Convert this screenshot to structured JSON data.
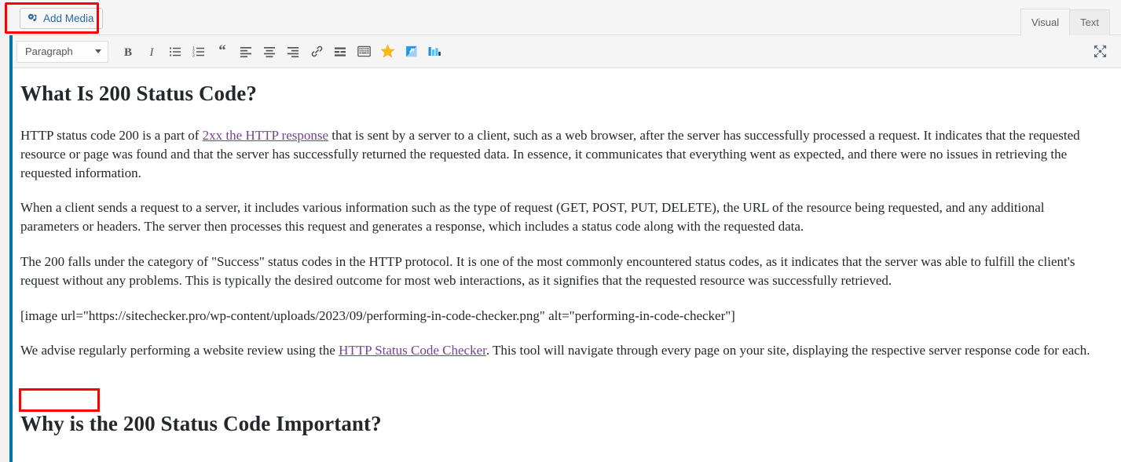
{
  "editor": {
    "add_media_label": "Add Media",
    "tabs": [
      {
        "label": "Visual",
        "active": true
      },
      {
        "label": "Text",
        "active": false
      }
    ],
    "toolbar": {
      "format_select_value": "Paragraph",
      "buttons": [
        {
          "name": "bold-button",
          "label": "B"
        },
        {
          "name": "italic-button",
          "label": "I"
        },
        {
          "name": "bulleted-list-button",
          "label": ""
        },
        {
          "name": "numbered-list-button",
          "label": ""
        },
        {
          "name": "blockquote-button",
          "label": "“"
        },
        {
          "name": "align-left-button",
          "label": ""
        },
        {
          "name": "align-center-button",
          "label": ""
        },
        {
          "name": "align-right-button",
          "label": ""
        },
        {
          "name": "insert-link-button",
          "label": ""
        },
        {
          "name": "read-more-button",
          "label": ""
        },
        {
          "name": "toolbar-toggle-button",
          "label": ""
        },
        {
          "name": "star-rating-button",
          "label": ""
        },
        {
          "name": "insert-media-blue-button",
          "label": ""
        },
        {
          "name": "insert-chart-button",
          "label": ""
        }
      ],
      "fullscreen_label": "Distraction-free writing mode"
    }
  },
  "document": {
    "heading1": "What Is 200 Status Code?",
    "para1_before_link": "HTTP status code 200 is a part of ",
    "para1_link": "2xx the HTTP response",
    "para1_after_link": " that is sent by a server to a client, such as a web browser, after the server has successfully processed a request. It indicates that the requested resource or page was found and that the server has successfully returned the requested data. In essence, it communicates that everything went as expected, and there were no issues in retrieving the requested information.",
    "para2": "When a client sends a request to a server, it includes various information such as the type of request (GET, POST, PUT, DELETE), the URL of the resource being requested, and any additional parameters or headers. The server then processes this request and generates a response, which includes a status code along with the requested data.",
    "para3": "The 200 falls under the category of \"Success\" status codes in the HTTP protocol. It is one of the most commonly encountered status codes, as it indicates that the server was able to fulfill the client's request without any problems. This is typically the desired outcome for most web interactions, as it signifies that the requested resource was successfully retrieved.",
    "shortcode": "[image url=\"https://sitechecker.pro/wp-content/uploads/2023/09/performing-in-code-checker.png\" alt=\"performing-in-code-checker\"]",
    "para5_before_link": "We advise regularly performing a website review using the ",
    "para5_link": "HTTP Status Code Checker",
    "para5_after_link": ". This tool will navigate through every page on your site, displaying the respective server response code for each.",
    "heading2": "Why is the 200 Status Code Important?"
  },
  "annotations": {
    "color": "#fd0000",
    "boxes": [
      {
        "name": "add-media-highlight",
        "target": "Add Media"
      },
      {
        "name": "empty-paragraph-highlight",
        "target": ""
      }
    ]
  },
  "colors": {
    "link": "#7a3f96",
    "accent_rail": "#0073aa",
    "add_media_text": "#2b6a9b",
    "annotation": "#fd0000"
  }
}
